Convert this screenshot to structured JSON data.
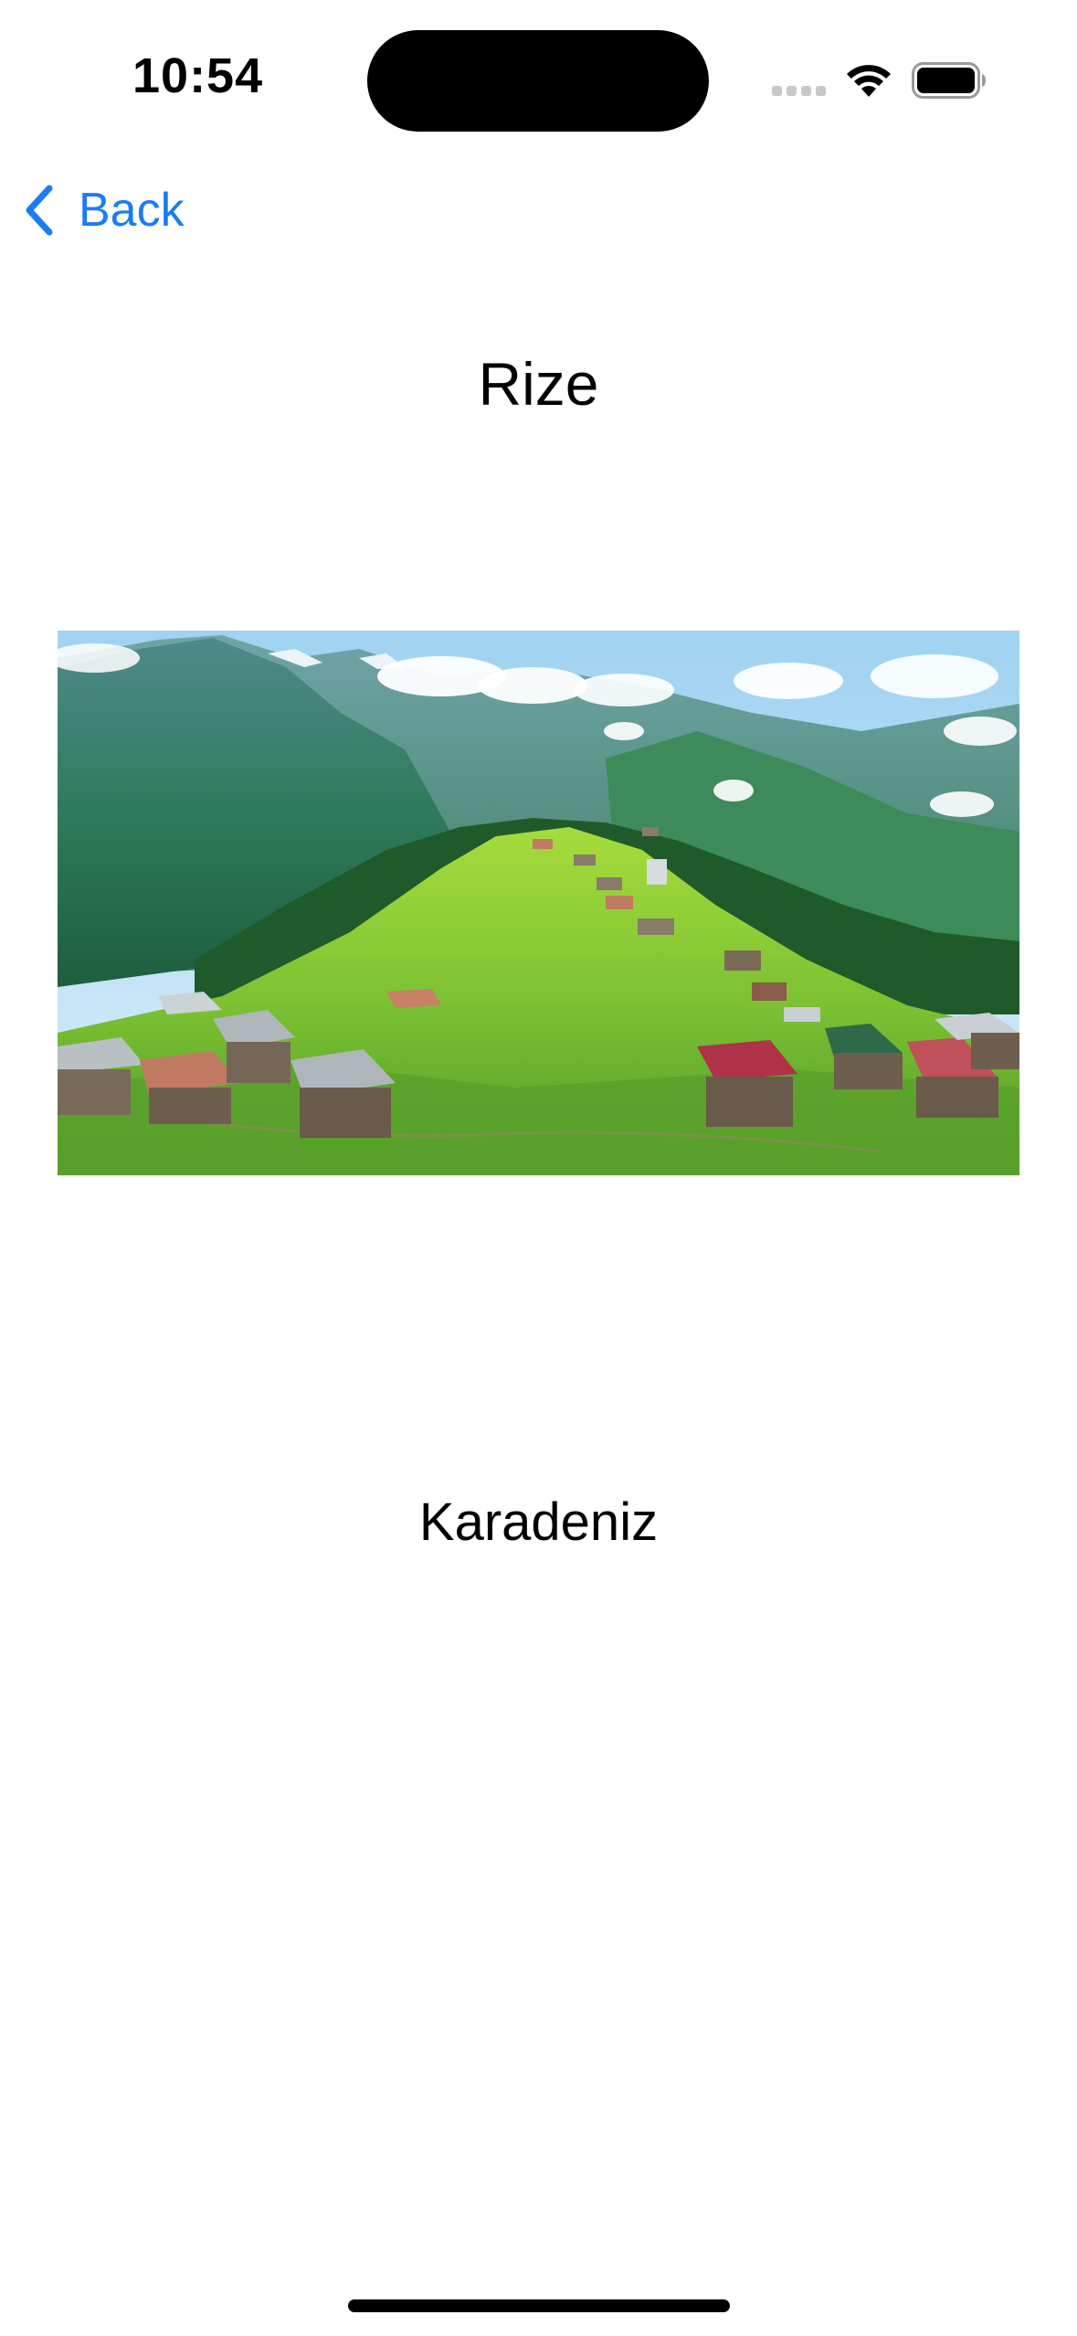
{
  "status_bar": {
    "time": "10:54"
  },
  "nav": {
    "back_label": "Back",
    "back_icon": "chevron-left-icon",
    "accent_color": "#1a7cf4"
  },
  "detail": {
    "title": "Rize",
    "image_alt": "Rize",
    "region": "Karadeniz"
  },
  "icons": {
    "signal": "cellular-signal-icon",
    "wifi": "wifi-icon",
    "battery": "battery-icon"
  }
}
